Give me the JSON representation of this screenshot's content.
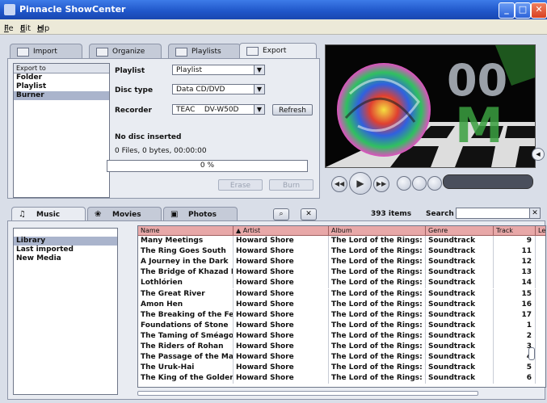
{
  "window": {
    "title": "Pinnacle ShowCenter"
  },
  "menu": [
    {
      "label": "File",
      "key": "F",
      "rest": "ile"
    },
    {
      "label": "Edit",
      "key": "E",
      "rest": "dit"
    },
    {
      "label": "Help",
      "key": "H",
      "rest": "elp"
    }
  ],
  "top_tabs": [
    {
      "label": "Import",
      "icon": "import-icon"
    },
    {
      "label": "Organize",
      "icon": "organize-icon"
    },
    {
      "label": "Playlists",
      "icon": "playlist-icon"
    },
    {
      "label": "Export",
      "icon": "export-icon"
    }
  ],
  "export": {
    "list_header": "Export to",
    "targets": [
      "Folder",
      "Playlist",
      "Burner"
    ],
    "selected_target": "Burner",
    "playlist_label": "Playlist",
    "playlist_value": "Playlist",
    "disctype_label": "Disc type",
    "disctype_value": "Data CD/DVD",
    "recorder_label": "Recorder",
    "recorder_value": "TEAC    DV-W50D",
    "refresh_label": "Refresh",
    "status": "No disc inserted",
    "summary": "0 Files, 0 bytes, 00:00:00",
    "progress_text": "0 %",
    "progress_fraction": 0,
    "erase_label": "Erase",
    "burn_label": "Burn"
  },
  "bottom_tabs": [
    {
      "label": "Music",
      "icon": "♫"
    },
    {
      "label": "Movies",
      "icon": "❀"
    },
    {
      "label": "Photos",
      "icon": "▣"
    }
  ],
  "library": {
    "count": "393 items",
    "search_label": "Search",
    "search_value": "",
    "sources": [
      "Library",
      "Last imported",
      "New Media"
    ],
    "selected_source": "Library",
    "columns": [
      "Name",
      "▲ Artist",
      "Album",
      "Genre",
      "Track",
      "Le"
    ],
    "rows": [
      {
        "name": "Many Meetings",
        "artist": "Howard Shore",
        "album": "The Lord of the Rings: T",
        "genre": "Soundtrack",
        "track": "9"
      },
      {
        "name": "The Ring Goes South",
        "artist": "Howard Shore",
        "album": "The Lord of the Rings: T",
        "genre": "Soundtrack",
        "track": "11"
      },
      {
        "name": "A Journey in the Dark",
        "artist": "Howard Shore",
        "album": "The Lord of the Rings: T",
        "genre": "Soundtrack",
        "track": "12"
      },
      {
        "name": "The Bridge of Khazad Du",
        "artist": "Howard Shore",
        "album": "The Lord of the Rings: T",
        "genre": "Soundtrack",
        "track": "13"
      },
      {
        "name": "Lothlórien",
        "artist": "Howard Shore",
        "album": "The Lord of the Rings: T",
        "genre": "Soundtrack",
        "track": "14"
      },
      {
        "name": "The Great River",
        "artist": "Howard Shore",
        "album": "The Lord of the Rings: T",
        "genre": "Soundtrack",
        "track": "15"
      },
      {
        "name": "Amon Hen",
        "artist": "Howard Shore",
        "album": "The Lord of the Rings: T",
        "genre": "Soundtrack",
        "track": "16"
      },
      {
        "name": "The Breaking of the Fell",
        "artist": "Howard Shore",
        "album": "The Lord of the Rings: T",
        "genre": "Soundtrack",
        "track": "17"
      },
      {
        "name": "Foundations of Stone",
        "artist": "Howard Shore",
        "album": "The Lord of the Rings: T",
        "genre": "Soundtrack",
        "track": "1"
      },
      {
        "name": "The Taming of Sméagol",
        "artist": "Howard Shore",
        "album": "The Lord of the Rings: T",
        "genre": "Soundtrack",
        "track": "2"
      },
      {
        "name": "The Riders of Rohan",
        "artist": "Howard Shore",
        "album": "The Lord of the Rings: T",
        "genre": "Soundtrack",
        "track": "3"
      },
      {
        "name": "The Passage of the Mars",
        "artist": "Howard Shore",
        "album": "The Lord of the Rings: T",
        "genre": "Soundtrack",
        "track": "4"
      },
      {
        "name": "The Uruk-Hai",
        "artist": "Howard Shore",
        "album": "The Lord of the Rings: T",
        "genre": "Soundtrack",
        "track": "5"
      },
      {
        "name": "The King of the Golden H",
        "artist": "Howard Shore",
        "album": "The Lord of the Rings: T",
        "genre": "Soundtrack",
        "track": "6"
      }
    ]
  },
  "colors": {
    "title_blue": "#1f55c8",
    "header_pink": "#e8a8a8",
    "selection": "#aab4cc"
  }
}
